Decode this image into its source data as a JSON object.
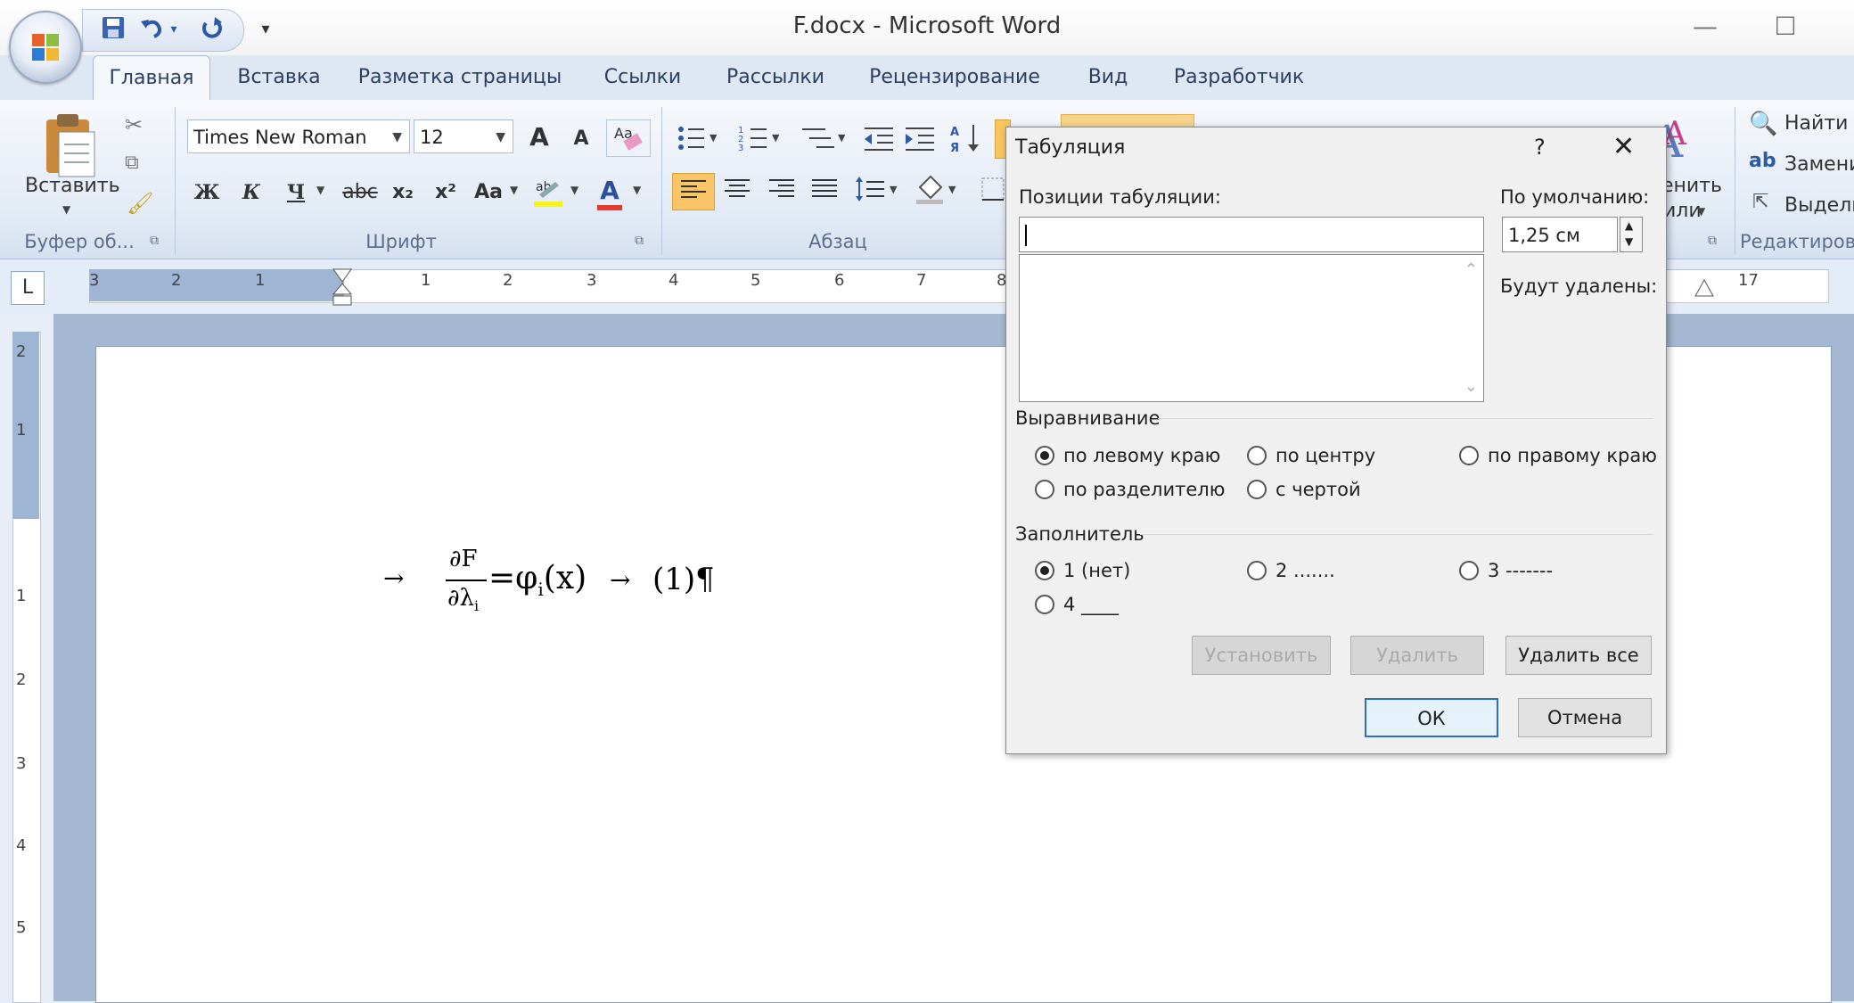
{
  "window": {
    "title": "F.docx - Microsoft Word"
  },
  "qat": {
    "save_icon": "save-icon",
    "undo_icon": "undo-icon",
    "redo_icon": "redo-icon",
    "customize_icon": "dropdown-icon"
  },
  "ribbon_tabs": [
    "Главная",
    "Вставка",
    "Разметка страницы",
    "Ссылки",
    "Рассылки",
    "Рецензирование",
    "Вид",
    "Разработчик"
  ],
  "ribbon": {
    "paste_label": "Вставить",
    "font_name": "Times New Roman",
    "font_size": "12",
    "groups": {
      "clipboard": "Буфер об...",
      "font": "Шрифт",
      "paragraph": "Абзац",
      "editing": "Редактиров"
    },
    "find_label": "Найти",
    "replace_label": "Замени",
    "select_label": "Выдели",
    "styles_partial": "енить",
    "styles_partial2": "или",
    "bold": "Ж",
    "italic": "К",
    "underline": "Ч",
    "strike": "abc",
    "subscript": "x₂",
    "superscript": "x²",
    "case": "Aa",
    "grow": "A",
    "shrink": "A",
    "font_color": "A"
  },
  "ruler": {
    "tab_selector": "L",
    "numbers": [
      "3",
      "2",
      "1",
      "1",
      "2",
      "3",
      "4",
      "5",
      "6",
      "7",
      "8"
    ],
    "right_number": "17",
    "vertical_numbers": [
      "2",
      "1",
      "1",
      "2",
      "3",
      "4",
      "5"
    ]
  },
  "document": {
    "formula_num": "∂F",
    "formula_den": "∂λ",
    "formula_den_sub": "i",
    "formula_rhs": "=φ",
    "formula_rhs_sub": "i",
    "formula_arg": "(x)",
    "equation_label": "(1)",
    "pilcrow": "¶",
    "tab_arrow": "→"
  },
  "dialog": {
    "title": "Табуляция",
    "help": "?",
    "close": "✕",
    "positions_label": "Позиции табуляции:",
    "positions_value": "",
    "default_label": "По умолчанию:",
    "default_value": "1,25 см",
    "will_delete_label": "Будут удалены:",
    "alignment_label": "Выравнивание",
    "alignment_options": [
      "по левому краю",
      "по центру",
      "по правому краю",
      "по разделителю",
      "с чертой"
    ],
    "alignment_selected": "по левому краю",
    "leader_label": "Заполнитель",
    "leader_options": [
      "1 (нет)",
      "2 .......",
      "3 -------",
      "4 ____"
    ],
    "leader_selected": "1 (нет)",
    "btn_set": "Установить",
    "btn_clear": "Удалить",
    "btn_clear_all": "Удалить все",
    "btn_ok": "ОК",
    "btn_cancel": "Отмена"
  }
}
